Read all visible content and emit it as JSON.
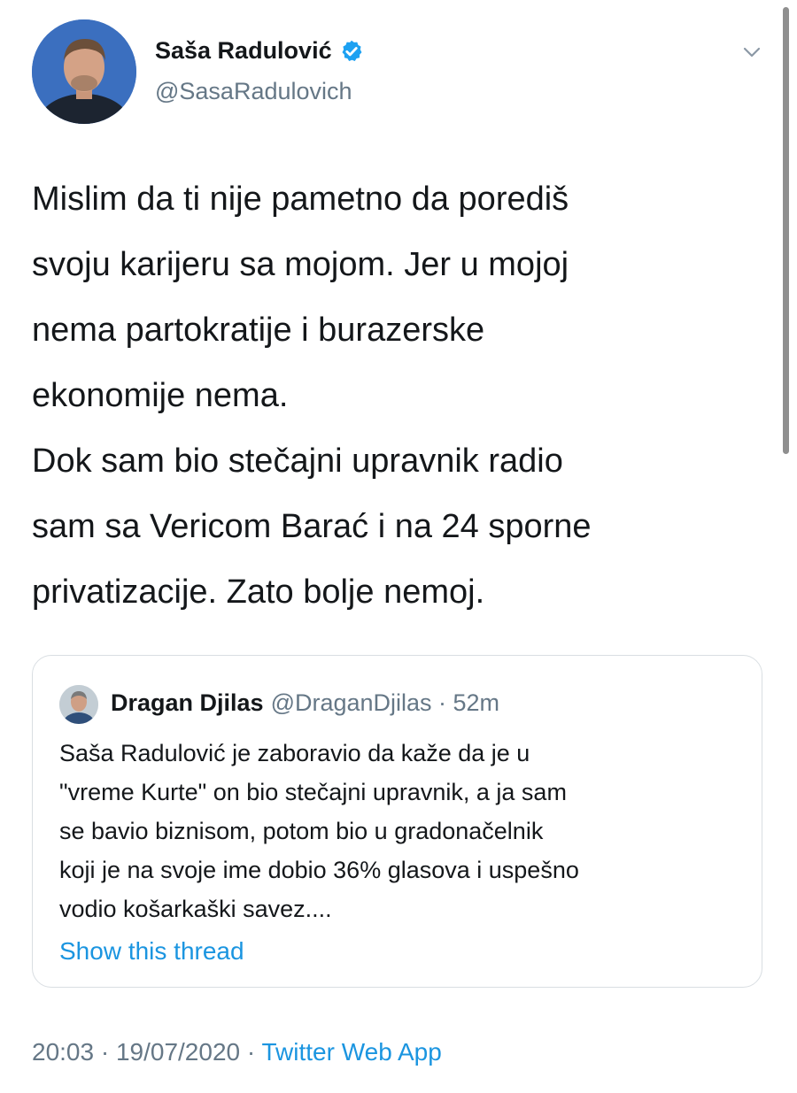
{
  "author": {
    "name": "Saša Radulović",
    "handle": "@SasaRadulovich",
    "verified": true
  },
  "tweet": {
    "text": "Mislim da ti nije pametno da porediš\nsvoju karijeru sa mojom. Jer u mojoj\nnema partokratije i burazerske\nekonomije nema.\nDok sam bio stečajni upravnik radio\nsam sa Vericom Barać i na 24 sporne\nprivatizacije. Zato bolje nemoj."
  },
  "quoted_tweet": {
    "author_name": "Dragan Djilas",
    "handle_time": "@DraganDjilas · 52m",
    "text": "Saša Radulović je zaboravio da kaže da je u\n\"vreme Kurte\" on bio stečajni upravnik, a ja sam\nse bavio biznisom, potom bio u gradonačelnik\nkoji je na svoje ime dobio 36% glasova i  uspešno\nvodio košarkaški savez....",
    "show_thread": "Show this thread"
  },
  "meta": {
    "datetime": "20:03 · 19/07/2020 · ",
    "source": "Twitter Web App"
  },
  "icons": {
    "verified": "verified-badge-icon",
    "caret": "chevron-down-icon"
  },
  "colors": {
    "link": "#1b95e0",
    "secondary_text": "#657786",
    "primary_text": "#14171a",
    "verified": "#1da1f2",
    "border": "#d9dee2"
  }
}
